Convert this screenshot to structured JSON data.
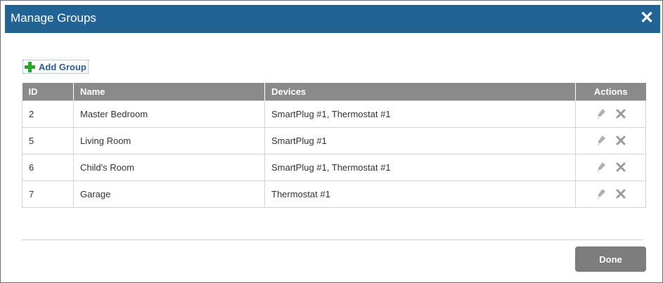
{
  "dialog": {
    "title": "Manage Groups",
    "close_label": "✕"
  },
  "toolbar": {
    "add_group_label": "Add Group"
  },
  "table": {
    "headers": {
      "id": "ID",
      "name": "Name",
      "devices": "Devices",
      "actions": "Actions"
    },
    "rows": [
      {
        "id": "2",
        "name": "Master Bedroom",
        "devices": "SmartPlug #1, Thermostat #1"
      },
      {
        "id": "5",
        "name": "Living Room",
        "devices": "SmartPlug #1"
      },
      {
        "id": "6",
        "name": "Child's Room",
        "devices": "SmartPlug #1, Thermostat #1"
      },
      {
        "id": "7",
        "name": "Garage",
        "devices": "Thermostat #1"
      }
    ]
  },
  "footer": {
    "done_label": "Done"
  },
  "icons": {
    "add": "plus-icon",
    "edit": "pencil-icon",
    "delete": "close-x-icon",
    "close": "close-icon"
  },
  "colors": {
    "titlebar": "#226395",
    "header": "#8a8a8a",
    "add_plus": "#2ea52e",
    "add_text": "#2b5b9a",
    "done_button": "#7d7d7d"
  }
}
